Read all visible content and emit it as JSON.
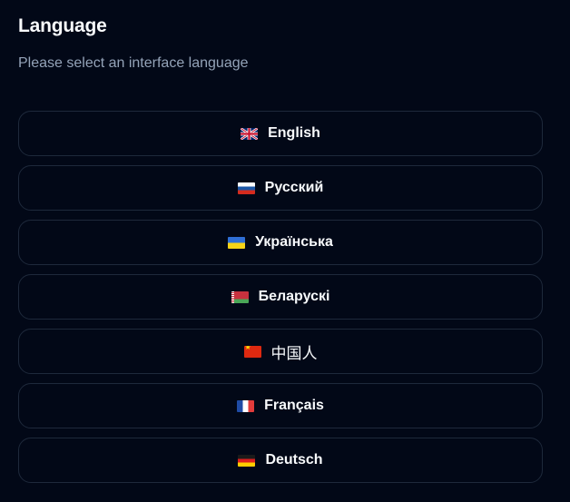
{
  "header": {
    "title": "Language",
    "subtitle": "Please select an interface language"
  },
  "languages": [
    {
      "label": "English",
      "flag": "uk-flag-icon"
    },
    {
      "label": "Русский",
      "flag": "russia-flag-icon"
    },
    {
      "label": "Українська",
      "flag": "ukraine-flag-icon"
    },
    {
      "label": "Беларускі",
      "flag": "belarus-flag-icon"
    },
    {
      "label": "中国人",
      "flag": "china-flag-icon"
    },
    {
      "label": "Français",
      "flag": "france-flag-icon"
    },
    {
      "label": "Deutsch",
      "flag": "germany-flag-icon"
    }
  ],
  "colors": {
    "background": "#020817",
    "border": "#1e293b",
    "text": "#f8fafc",
    "muted_text": "#94a3b8"
  }
}
